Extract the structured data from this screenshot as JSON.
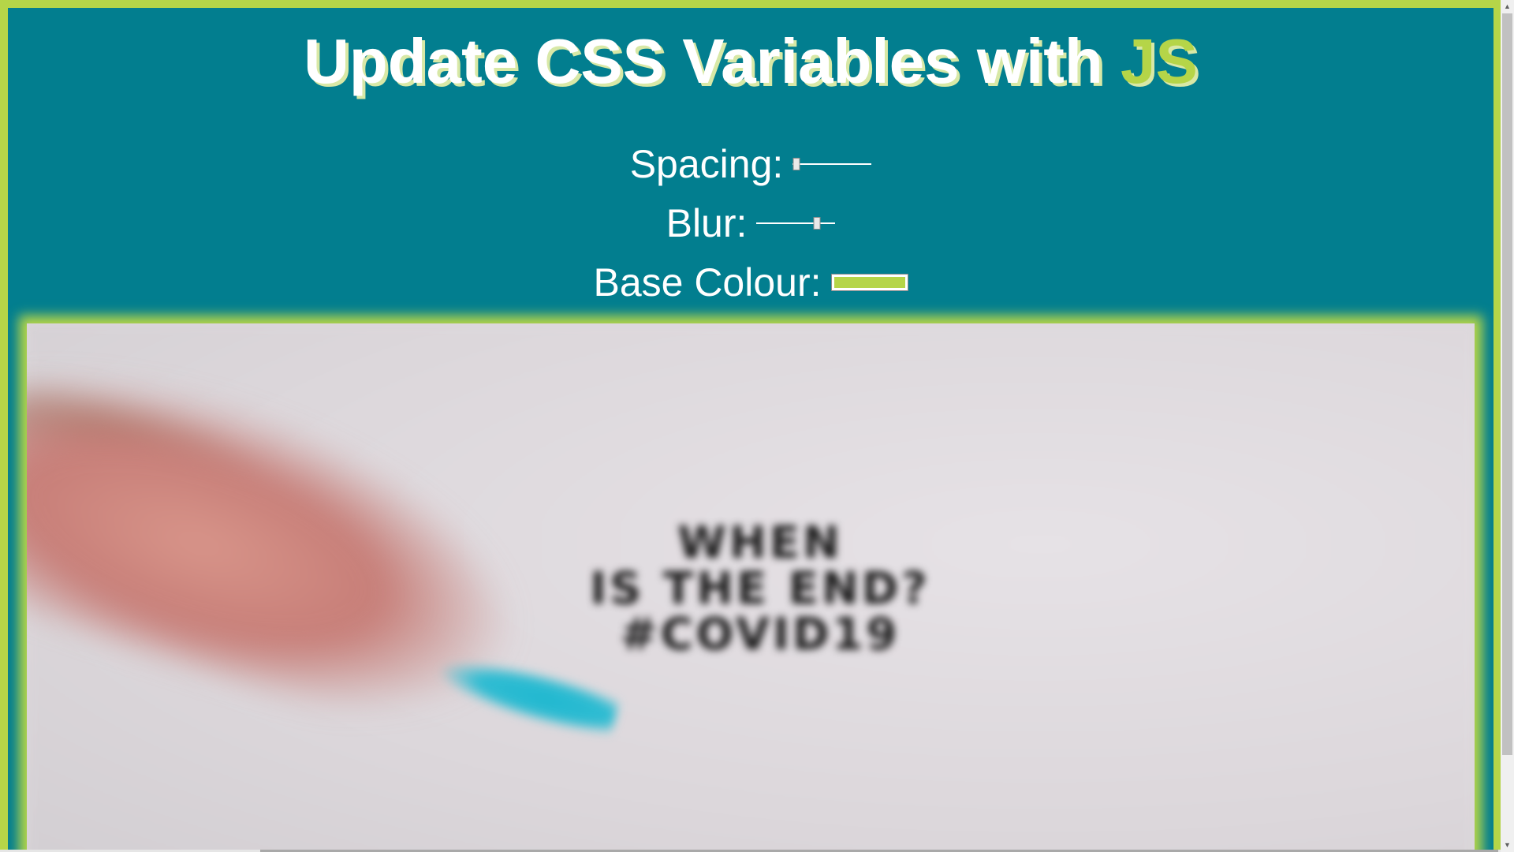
{
  "heading": {
    "text": "Update CSS Variables with ",
    "highlight": "JS"
  },
  "controls": {
    "spacing": {
      "label": "Spacing:",
      "min": 10,
      "max": 200,
      "value": 10
    },
    "blur": {
      "label": "Blur:",
      "min": 0,
      "max": 25,
      "value": 20
    },
    "base_colour": {
      "label": "Base Colour:",
      "value": "#b5d548"
    }
  },
  "photo": {
    "alt_text_lines": [
      "WHEN",
      "IS THE END?",
      "#COVID19"
    ]
  },
  "colors": {
    "page_background": "#027e8f",
    "base": "#b5d548",
    "text": "#ffffff"
  },
  "scrollbar_icons": {
    "up": "scroll-up-arrow-icon",
    "down": "scroll-down-arrow-icon"
  }
}
